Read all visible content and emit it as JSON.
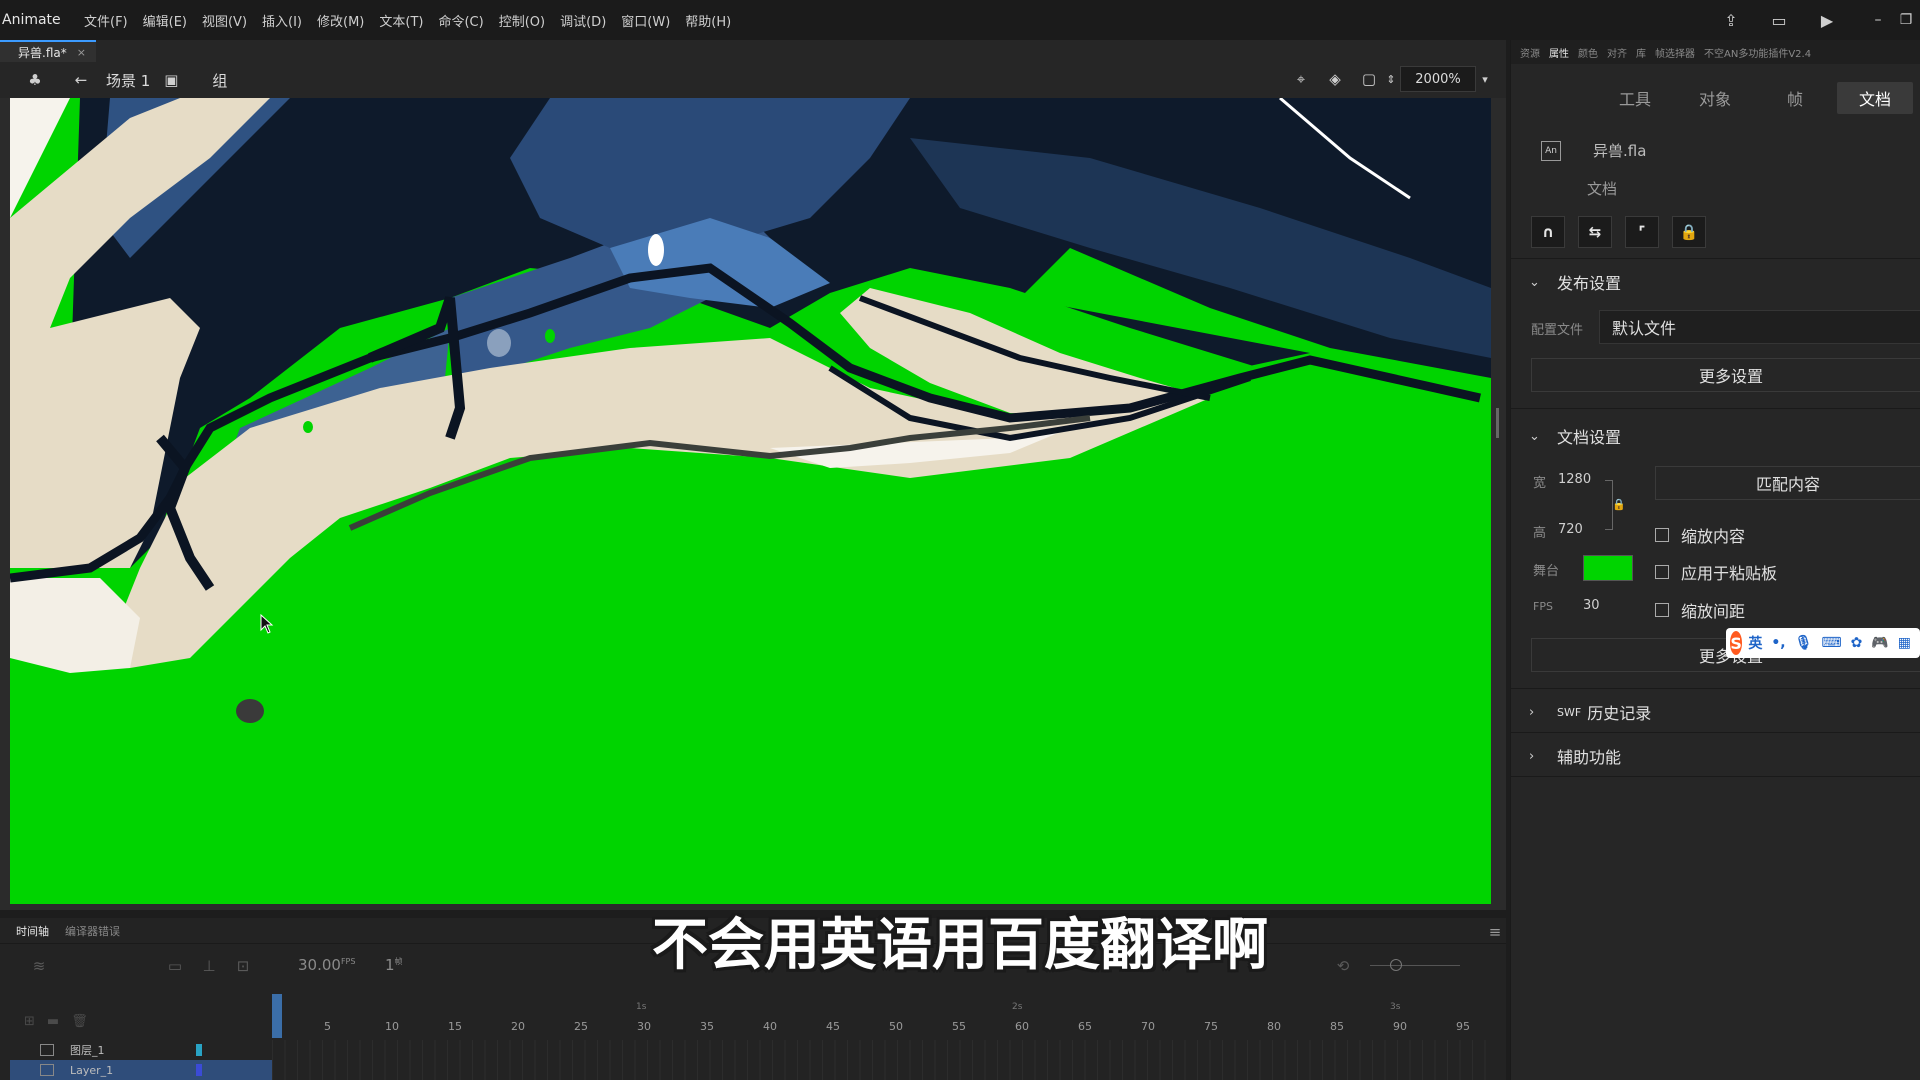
{
  "app": {
    "name": "Animate"
  },
  "menu": [
    "文件(F)",
    "编辑(E)",
    "视图(V)",
    "插入(I)",
    "修改(M)",
    "文本(T)",
    "命令(C)",
    "控制(O)",
    "调试(D)",
    "窗口(W)",
    "帮助(H)"
  ],
  "doc_tab": {
    "label": "异兽.fla*",
    "close": "×"
  },
  "editbar": {
    "scene": "场景 1",
    "group": "组",
    "zoom": "2000%"
  },
  "timeline": {
    "tabs": [
      "时间轴",
      "编译器错误"
    ],
    "fps": "30.00",
    "fps_unit": "FPS",
    "current_frame": "1",
    "frame_unit": "帧",
    "ruler_ticks": [
      "5",
      "10",
      "15",
      "20",
      "25",
      "30",
      "35",
      "40",
      "45",
      "50",
      "55",
      "60",
      "65",
      "70",
      "75",
      "80",
      "85",
      "90",
      "95"
    ],
    "ruler_seconds": [
      "1s",
      "2s",
      "3s"
    ],
    "layers": [
      {
        "name": "图层_1",
        "selected": false,
        "color": "#29a3c4"
      },
      {
        "name": "Layer_1",
        "selected": true,
        "color": "#3b4bd6"
      }
    ]
  },
  "panel": {
    "tabs": [
      "资源",
      "属性",
      "颜色",
      "对齐",
      "库",
      "帧选择器",
      "不空AN多功能插件V2.4"
    ],
    "active_tab": "属性",
    "segments": [
      "工具",
      "对象",
      "帧",
      "文档"
    ],
    "active_segment": "文档",
    "doc_icon": "An",
    "doc_name": "异兽.fla",
    "doc_type": "文档",
    "publish": {
      "title": "发布设置",
      "profile_label": "配置文件",
      "profile_value": "默认文件",
      "more_button": "更多设置"
    },
    "doc_settings": {
      "title": "文档设置",
      "width_label": "宽",
      "width_value": "1280",
      "height_label": "高",
      "height_value": "720",
      "match_button": "匹配内容",
      "scale_content": "缩放内容",
      "apply_pasteboard": "应用于粘贴板",
      "scale_spacing": "缩放间距",
      "stage_label": "舞台",
      "stage_color": "#00d400",
      "fps_label": "FPS",
      "fps_value": "30",
      "more_button": "更多设置"
    },
    "swf_history": {
      "prefix": "SWF",
      "title": "历史记录"
    },
    "accessibility": "辅助功能"
  },
  "ime": {
    "logo": "S",
    "mode": "英"
  },
  "subtitle": "不会用英语用百度翻译啊"
}
